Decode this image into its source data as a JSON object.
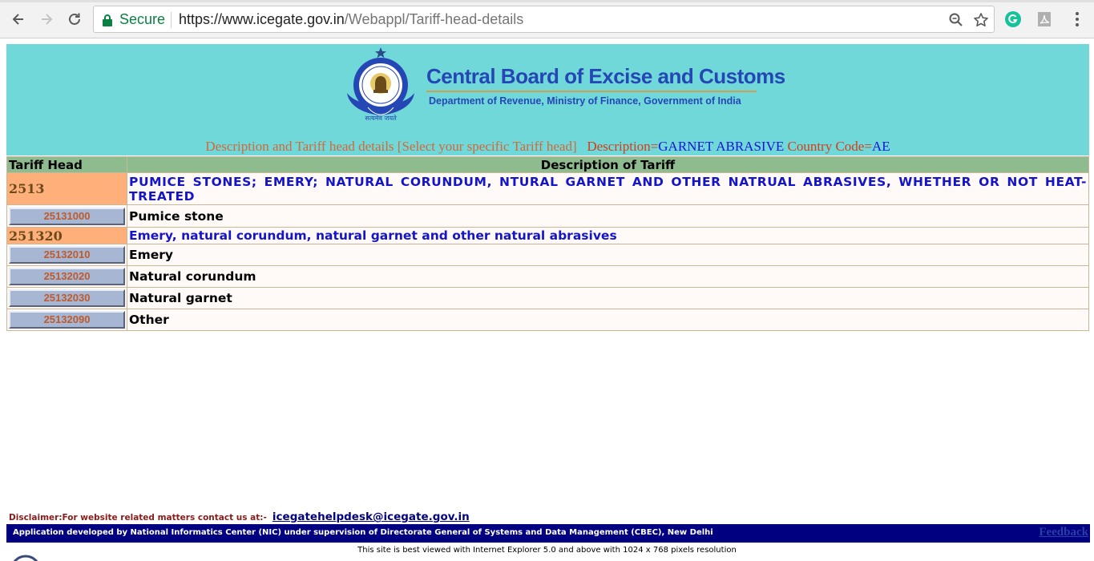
{
  "browser": {
    "secure_label": "Secure",
    "url_host": "https://www.icegate.gov.in",
    "url_path": "/Webappl/Tariff-head-details",
    "icons": [
      "back-icon",
      "forward-icon",
      "reload-icon",
      "lock-icon",
      "zoom-icon",
      "star-icon",
      "grammarly-icon",
      "pdf-extension-icon",
      "menu-icon"
    ],
    "secure_color": "#0b8043"
  },
  "header": {
    "org_title": "Central Board of Excise and Customs",
    "org_subtitle": "Department of Revenue, Ministry of Finance, Government of India",
    "emblem_motto": "सत्यमेव जयते",
    "banner_color": "#70d8d8"
  },
  "search": {
    "title": "Description and Tariff head details [Select your specific Tariff head]",
    "description_label": "Description",
    "description_eq": "=",
    "description_value": "GARNET ABRASIVE",
    "country_label": "Country Code",
    "country_eq": "=",
    "country_value": "AE"
  },
  "table": {
    "headers": [
      "Tariff Head",
      "Description of Tariff"
    ],
    "rows": [
      {
        "type": "heading",
        "code": "2513",
        "description": "PUMICE STONES; EMERY; NATURAL CORUNDUM, NTURAL GARNET AND OTHER NATRUAL ABRASIVES, WHETHER OR NOT HEAT-TREATED"
      },
      {
        "type": "item",
        "code": "25131000",
        "description": "Pumice stone"
      },
      {
        "type": "heading",
        "code": "251320",
        "description": "Emery, natural corundum, natural garnet and other natural abrasives"
      },
      {
        "type": "item",
        "code": "25132010",
        "description": "Emery"
      },
      {
        "type": "item",
        "code": "25132020",
        "description": "Natural corundum"
      },
      {
        "type": "item",
        "code": "25132030",
        "description": "Natural garnet"
      },
      {
        "type": "item",
        "code": "25132090",
        "description": "Other"
      }
    ]
  },
  "footer": {
    "disclaimer_label": "Disclaimer:For website related matters contact us at:-",
    "email": "icegatehelpdesk@icegate.gov.in",
    "nic_text": "Application developed by National Informatics Center (NIC) under supervision of Directorate General of Systems and Data Management (CBEC), New Delhi",
    "feedback_label": "Feedback",
    "best_view": "This site is best viewed with Internet Explorer 5.0 and above with 1024 x 768 pixels resolution",
    "bar_color": "#000080"
  }
}
